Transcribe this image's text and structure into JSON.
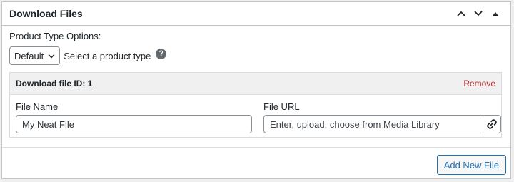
{
  "panel": {
    "title": "Download Files",
    "controls": {
      "up_icon": "chevron-up-icon",
      "down_icon": "chevron-down-icon",
      "toggle_icon": "triangle-up-icon"
    }
  },
  "product_type": {
    "label": "Product Type Options:",
    "select_value": "Default",
    "hint": "Select a product type",
    "help_icon": "question-mark-icon",
    "help_glyph": "?"
  },
  "download_file": {
    "header": "Download file ID: 1",
    "remove_label": "Remove",
    "file_name_label": "File Name",
    "file_name_value": "My Neat File",
    "file_url_label": "File URL",
    "file_url_placeholder": "Enter, upload, choose from Media Library",
    "link_icon": "link-icon"
  },
  "footer": {
    "add_button_label": "Add New File"
  },
  "colors": {
    "remove": "#b32d2e",
    "button_accent": "#2271b1"
  }
}
